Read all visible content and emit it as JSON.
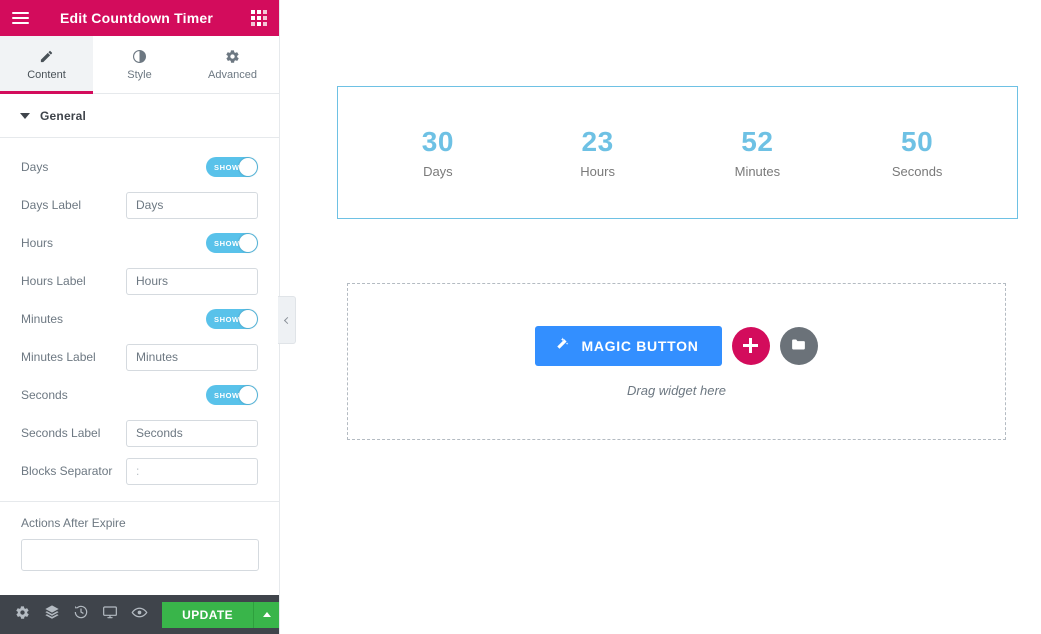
{
  "panel": {
    "header": {
      "title": "Edit Countdown Timer",
      "menu_icon": "hamburger-menu-icon",
      "widgets_icon": "widgets-grid-icon"
    },
    "tabs": [
      {
        "label": "Content",
        "icon": "pencil-icon",
        "active": true
      },
      {
        "label": "Style",
        "icon": "contrast-icon",
        "active": false
      },
      {
        "label": "Advanced",
        "icon": "gear-icon",
        "active": false
      }
    ],
    "section": {
      "title": "General",
      "expanded": true
    },
    "controls": [
      {
        "label": "Days",
        "type": "switch",
        "state": "SHOW"
      },
      {
        "label": "Days Label",
        "type": "text",
        "value": "Days",
        "placeholder": ""
      },
      {
        "label": "Hours",
        "type": "switch",
        "state": "SHOW"
      },
      {
        "label": "Hours Label",
        "type": "text",
        "value": "Hours",
        "placeholder": ""
      },
      {
        "label": "Minutes",
        "type": "switch",
        "state": "SHOW"
      },
      {
        "label": "Minutes Label",
        "type": "text",
        "value": "Minutes",
        "placeholder": ""
      },
      {
        "label": "Seconds",
        "type": "switch",
        "state": "SHOW"
      },
      {
        "label": "Seconds Label",
        "type": "text",
        "value": "Seconds",
        "placeholder": ""
      },
      {
        "label": "Blocks Separator",
        "type": "text",
        "value": "",
        "placeholder": ":"
      }
    ],
    "actions_after_expire": {
      "label": "Actions After Expire",
      "value": "",
      "placeholder": ""
    },
    "footer": {
      "buttons": [
        {
          "icon": "gear-icon",
          "name": "settings"
        },
        {
          "icon": "layers-icon",
          "name": "navigator"
        },
        {
          "icon": "history-icon",
          "name": "history"
        },
        {
          "icon": "monitor-icon",
          "name": "responsive-mode"
        },
        {
          "icon": "eye-icon",
          "name": "preview"
        }
      ],
      "update_label": "UPDATE",
      "update_caret_icon": "caret-up-icon"
    },
    "collapse_handle_icon": "chevron-left-icon"
  },
  "canvas": {
    "countdown": {
      "items": [
        {
          "digit": "30",
          "label": "Days"
        },
        {
          "digit": "23",
          "label": "Hours"
        },
        {
          "digit": "52",
          "label": "Minutes"
        },
        {
          "digit": "50",
          "label": "Seconds"
        }
      ]
    },
    "dropzone": {
      "magic_button_label": "MAGIC BUTTON",
      "magic_button_icon": "magic-wand-icon",
      "add_section_icon": "plus-icon",
      "template_library_icon": "folder-icon",
      "hint": "Drag widget here"
    }
  },
  "colors": {
    "brand_pink": "#d30c5c",
    "accent_blue": "#338fff",
    "toggle_blue": "#59c2ea",
    "countdown_blue": "#6ec1e4",
    "update_green": "#39b54a",
    "footer_dark": "#3f444b"
  }
}
